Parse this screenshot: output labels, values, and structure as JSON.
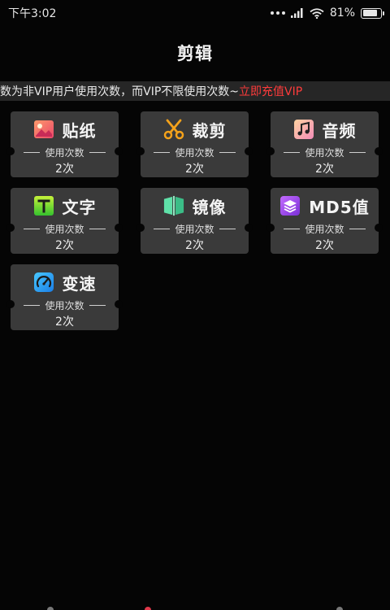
{
  "status_bar": {
    "time": "下午3:02",
    "battery": "81%",
    "battery_level": 0.81
  },
  "header": {
    "title": "剪辑"
  },
  "notice": {
    "text": "数为非VIP用户使用次数，而VIP不限使用次数~",
    "link": "立即充值VIP",
    "link_color": "#ff3b3b"
  },
  "tools": [
    {
      "label": "贴纸",
      "icon": "sticker-icon",
      "usage_label": "使用次数",
      "count": "2次"
    },
    {
      "label": "裁剪",
      "icon": "scissors-icon",
      "usage_label": "使用次数",
      "count": "2次"
    },
    {
      "label": "音频",
      "icon": "music-note-icon",
      "usage_label": "使用次数",
      "count": "2次"
    },
    {
      "label": "文字",
      "icon": "text-icon",
      "usage_label": "使用次数",
      "count": "2次"
    },
    {
      "label": "镜像",
      "icon": "mirror-icon",
      "usage_label": "使用次数",
      "count": "2次"
    },
    {
      "label": "MD5值",
      "icon": "layers-icon",
      "usage_label": "使用次数",
      "count": "2次"
    },
    {
      "label": "变速",
      "icon": "speedometer-icon",
      "usage_label": "使用次数",
      "count": "2次"
    }
  ],
  "colors": {
    "background": "#050505",
    "card": "#3a3a3a",
    "notice_bar": "#262626"
  }
}
